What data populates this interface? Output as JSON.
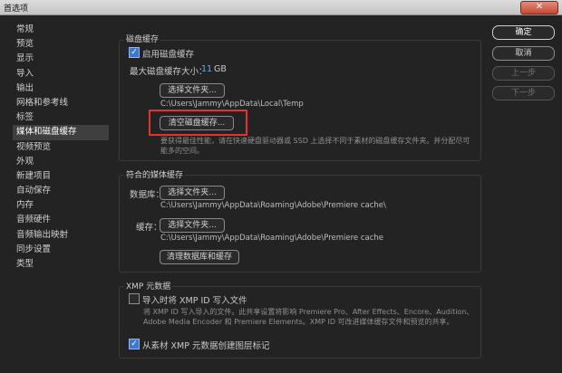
{
  "window": {
    "title": "首选项",
    "close_glyph": "✕"
  },
  "sidebar": {
    "items": [
      "常规",
      "预览",
      "显示",
      "导入",
      "输出",
      "网格和参考线",
      "标签",
      "媒体和磁盘缓存",
      "视频预览",
      "外观",
      "新建项目",
      "自动保存",
      "内存",
      "音频硬件",
      "音频输出映射",
      "同步设置",
      "类型"
    ],
    "active_index": 7
  },
  "disk_cache": {
    "group_label": "磁盘缓存",
    "enable_label": "启用磁盘缓存",
    "enabled": true,
    "max_size_label": "最大磁盘缓存大小：",
    "max_size_value": "11",
    "max_size_unit": "GB",
    "choose_folder_label": "选择文件夹...",
    "folder_path": "C:\\Users\\Jammy\\AppData\\Local\\Temp",
    "clear_button_label": "清空磁盘缓存...",
    "note": "要获得最佳性能，请在快速硬盘驱动器或 SSD 上选择不同于素材的磁盘缓存文件夹。并分配尽可能多的空间。"
  },
  "media_cache": {
    "group_label": "符合的媒体缓存",
    "database_label": "数据库：",
    "database_button": "选择文件夹...",
    "database_path": "C:\\Users\\Jammy\\AppData\\Roaming\\Adobe\\Premiere cache\\",
    "cache_label": "缓存：",
    "cache_button": "选择文件夹...",
    "cache_path": "C:\\Users\\Jammy\\AppData\\Roaming\\Adobe\\Premiere cache",
    "clean_button_label": "清理数据库和缓存"
  },
  "xmp": {
    "group_label": "XMP 元数据",
    "write_on_import_label": "导入时将 XMP ID 写入文件",
    "write_on_import_checked": false,
    "note": "将 XMP ID 写入导入的文件。此共享设置将影响 Premiere Pro、After Effects、Encore、Audition、Adobe Media Encoder 和 Premiere Elements。XMP ID 可改进媒体缓存文件和预览的共享。",
    "create_markers_label": "从素材 XMP 元数据创建图层标记",
    "create_markers_checked": true
  },
  "actions": {
    "ok": "确定",
    "cancel": "取消",
    "prev": "上一步",
    "next": "下一步"
  },
  "colors": {
    "highlight_border": "#e53130",
    "accent": "#3b78d6"
  }
}
